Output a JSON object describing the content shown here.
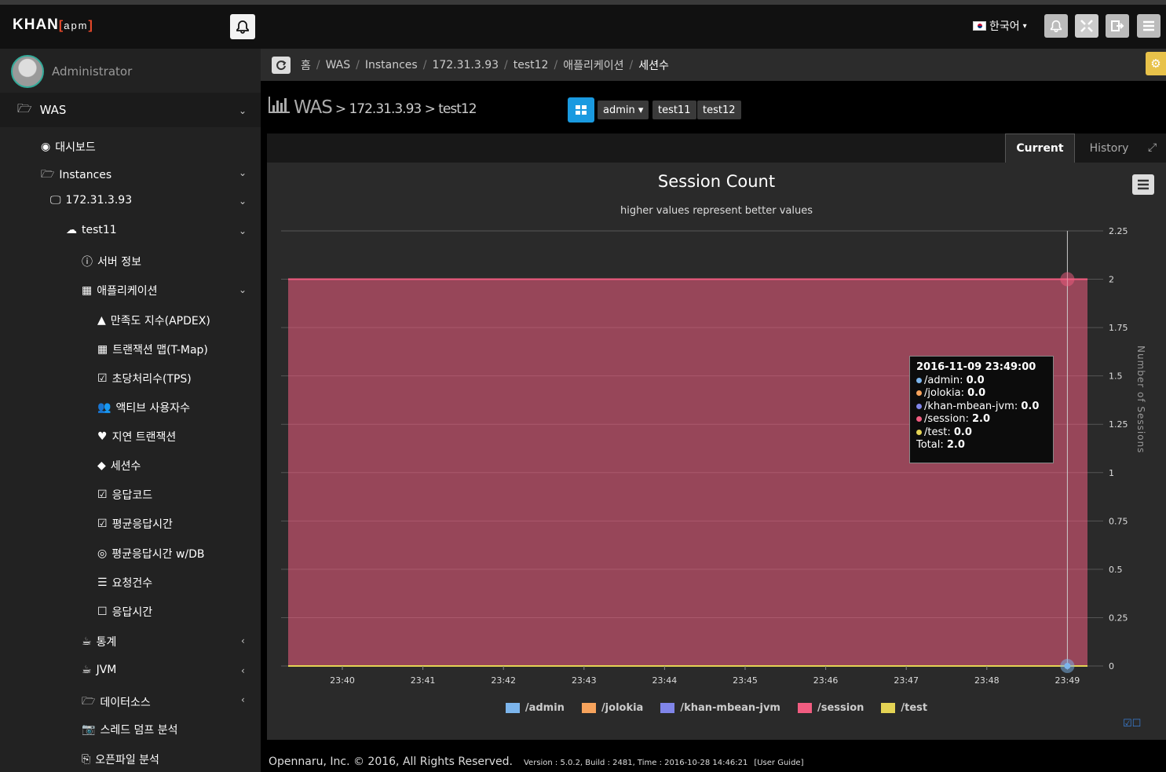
{
  "app": {
    "logo_main": "KHAN",
    "logo_sub": "apm"
  },
  "header": {
    "language": "한국어"
  },
  "sidebar": {
    "user": "Administrator",
    "was": "WAS",
    "items": [
      {
        "label": "대시보드"
      },
      {
        "label": "Instances"
      },
      {
        "label": "172.31.3.93"
      },
      {
        "label": "test11"
      },
      {
        "label": "서버 정보"
      },
      {
        "label": "애플리케이션"
      },
      {
        "label": "만족도 지수(APDEX)"
      },
      {
        "label": "트랜잭션 맵(T-Map)"
      },
      {
        "label": "초당처리수(TPS)"
      },
      {
        "label": "액티브 사용자수"
      },
      {
        "label": "지연 트랜잭션"
      },
      {
        "label": "세션수"
      },
      {
        "label": "응답코드"
      },
      {
        "label": "평균응답시간"
      },
      {
        "label": "평균응답시간 w/DB"
      },
      {
        "label": "요청건수"
      },
      {
        "label": "응답시간"
      },
      {
        "label": "통계"
      },
      {
        "label": "JVM"
      },
      {
        "label": "데이터소스"
      },
      {
        "label": "스레드 덤프 분석"
      },
      {
        "label": "오픈파일 분석"
      }
    ]
  },
  "breadcrumb": {
    "items": [
      "홈",
      "WAS",
      "Instances",
      "172.31.3.93",
      "test12",
      "애플리케이션",
      "세션수"
    ]
  },
  "page": {
    "title": "WAS",
    "path": "> 172.31.3.93 > test12",
    "dropdown": "admin ▾",
    "pill1": "test11",
    "pill2": "test12"
  },
  "tabs": {
    "current": "Current",
    "history": "History"
  },
  "tooltip": {
    "time": "2016-11-09 23:49:00",
    "rows": [
      {
        "name": "/admin: ",
        "value": "0.0",
        "color": "#7cb5ec"
      },
      {
        "name": "/jolokia: ",
        "value": "0.0",
        "color": "#f7a35c"
      },
      {
        "name": "/khan-mbean-jvm: ",
        "value": "0.0",
        "color": "#8085e9"
      },
      {
        "name": "/session: ",
        "value": "2.0",
        "color": "#f15c80"
      },
      {
        "name": "/test: ",
        "value": "0.0",
        "color": "#e4d354"
      }
    ],
    "total_label": "Total: ",
    "total": "2.0"
  },
  "chart_data": {
    "type": "area",
    "title": "Session Count",
    "subtitle": "higher values represent better values",
    "ylabel": "Number of Sessions",
    "ylim": [
      0,
      2.25
    ],
    "yticks": [
      "0",
      "0.25",
      "0.5",
      "0.75",
      "1",
      "1.25",
      "1.5",
      "1.75",
      "2",
      "2.25"
    ],
    "x": [
      "23:40",
      "23:41",
      "23:42",
      "23:43",
      "23:44",
      "23:45",
      "23:46",
      "23:47",
      "23:48",
      "23:49"
    ],
    "series": [
      {
        "name": "/admin",
        "color": "#7cb5ec",
        "values": [
          0,
          0,
          0,
          0,
          0,
          0,
          0,
          0,
          0,
          0
        ]
      },
      {
        "name": "/jolokia",
        "color": "#f7a35c",
        "values": [
          0,
          0,
          0,
          0,
          0,
          0,
          0,
          0,
          0,
          0
        ]
      },
      {
        "name": "/khan-mbean-jvm",
        "color": "#8085e9",
        "values": [
          0,
          0,
          0,
          0,
          0,
          0,
          0,
          0,
          0,
          0
        ]
      },
      {
        "name": "/session",
        "color": "#f15c80",
        "values": [
          2,
          2,
          2,
          2,
          2,
          2,
          2,
          2,
          2,
          2
        ]
      },
      {
        "name": "/test",
        "color": "#e4d354",
        "values": [
          0,
          0,
          0,
          0,
          0,
          0,
          0,
          0,
          0,
          0
        ]
      }
    ]
  },
  "footer": {
    "copyright": "Opennaru, Inc. © 2016, All Rights Reserved.",
    "version": "Version : 5.0.2, Build : 2481, Time : 2016-10-28 14:46:21",
    "guide": "[User Guide]"
  }
}
